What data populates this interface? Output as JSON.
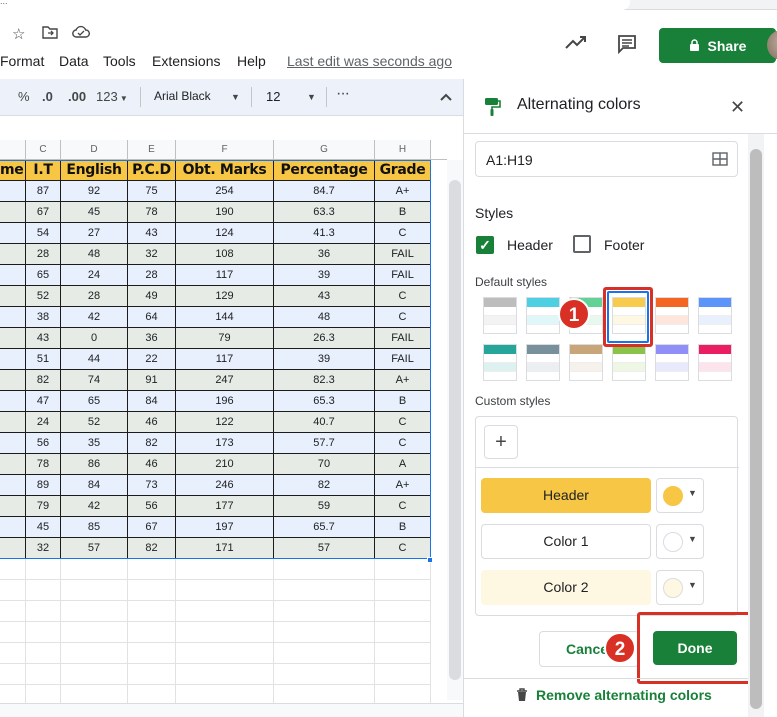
{
  "tab_fragment": "...",
  "menus": [
    "Format",
    "Data",
    "Tools",
    "Extensions",
    "Help"
  ],
  "last_edit": "Last edit was seconds ago",
  "share_label": "Share",
  "toolbar": {
    "percent": "%",
    "dec_decrease": ".0",
    "dec_increase": ".00",
    "format_123": "123",
    "font": "Arial Black",
    "font_size": "12",
    "more": "⋮"
  },
  "grid": {
    "column_letters": [
      "C",
      "D",
      "E",
      "F",
      "G",
      "H"
    ],
    "headers": [
      "me",
      "I.T",
      "English",
      "P.C.D",
      "Obt. Marks",
      "Percentage",
      "Grade"
    ],
    "rows": [
      [
        "",
        "87",
        "92",
        "75",
        "254",
        "84.7",
        "A+"
      ],
      [
        "",
        "67",
        "45",
        "78",
        "190",
        "63.3",
        "B"
      ],
      [
        "",
        "54",
        "27",
        "43",
        "124",
        "41.3",
        "C"
      ],
      [
        "",
        "28",
        "48",
        "32",
        "108",
        "36",
        "FAIL"
      ],
      [
        "",
        "65",
        "24",
        "28",
        "117",
        "39",
        "FAIL"
      ],
      [
        "",
        "52",
        "28",
        "49",
        "129",
        "43",
        "C"
      ],
      [
        "",
        "38",
        "42",
        "64",
        "144",
        "48",
        "C"
      ],
      [
        "",
        "43",
        "0",
        "36",
        "79",
        "26.3",
        "FAIL"
      ],
      [
        "",
        "51",
        "44",
        "22",
        "117",
        "39",
        "FAIL"
      ],
      [
        "",
        "82",
        "74",
        "91",
        "247",
        "82.3",
        "A+"
      ],
      [
        "",
        "47",
        "65",
        "84",
        "196",
        "65.3",
        "B"
      ],
      [
        "",
        "24",
        "52",
        "46",
        "122",
        "40.7",
        "C"
      ],
      [
        "",
        "56",
        "35",
        "82",
        "173",
        "57.7",
        "C"
      ],
      [
        "",
        "78",
        "86",
        "46",
        "210",
        "70",
        "A"
      ],
      [
        "",
        "89",
        "84",
        "73",
        "246",
        "82",
        "A+"
      ],
      [
        "",
        "79",
        "42",
        "56",
        "177",
        "59",
        "C"
      ],
      [
        "",
        "45",
        "85",
        "67",
        "197",
        "65.7",
        "B"
      ],
      [
        "",
        "32",
        "57",
        "82",
        "171",
        "57",
        "C"
      ]
    ]
  },
  "panel": {
    "title": "Alternating colors",
    "range": "A1:H19",
    "styles_label": "Styles",
    "header_label": "Header",
    "footer_label": "Footer",
    "default_styles_label": "Default styles",
    "custom_styles_label": "Custom styles",
    "add_label": "+",
    "header_btn": "Header",
    "color1_btn": "Color 1",
    "color2_btn": "Color 2",
    "cancel_label": "Cancel",
    "done_label": "Done",
    "remove_label": "Remove alternating colors",
    "badge1": "1",
    "badge2": "2"
  },
  "swatches": [
    [
      "#bdbdbd",
      "#ffffff",
      "#f3f3f3"
    ],
    [
      "#4dd0e1",
      "#ffffff",
      "#e0f7fa"
    ],
    [
      "#63d297",
      "#ffffff",
      "#e7f9ef"
    ],
    [
      "#f7cb4d",
      "#ffffff",
      "#fef8e3"
    ],
    [
      "#f46524",
      "#ffffff",
      "#ffe6dd"
    ],
    [
      "#5b95f9",
      "#ffffff",
      "#e8f0fe"
    ],
    [
      "#26a69a",
      "#ffffff",
      "#ddf2f0"
    ],
    [
      "#78909c",
      "#ffffff",
      "#ebeff1"
    ],
    [
      "#c9a57a",
      "#ffffff",
      "#f6f1eb"
    ],
    [
      "#8bc34a",
      "#ffffff",
      "#eef7e3"
    ],
    [
      "#8f8ff7",
      "#ffffff",
      "#e9e9fd"
    ],
    [
      "#e91e63",
      "#ffffff",
      "#fde4ec"
    ]
  ],
  "colors": {
    "header_fill": "#f6c644",
    "color1": "#ffffff",
    "color2": "#fff8e1",
    "accent_green": "#188038",
    "annotation_red": "#d93025"
  }
}
